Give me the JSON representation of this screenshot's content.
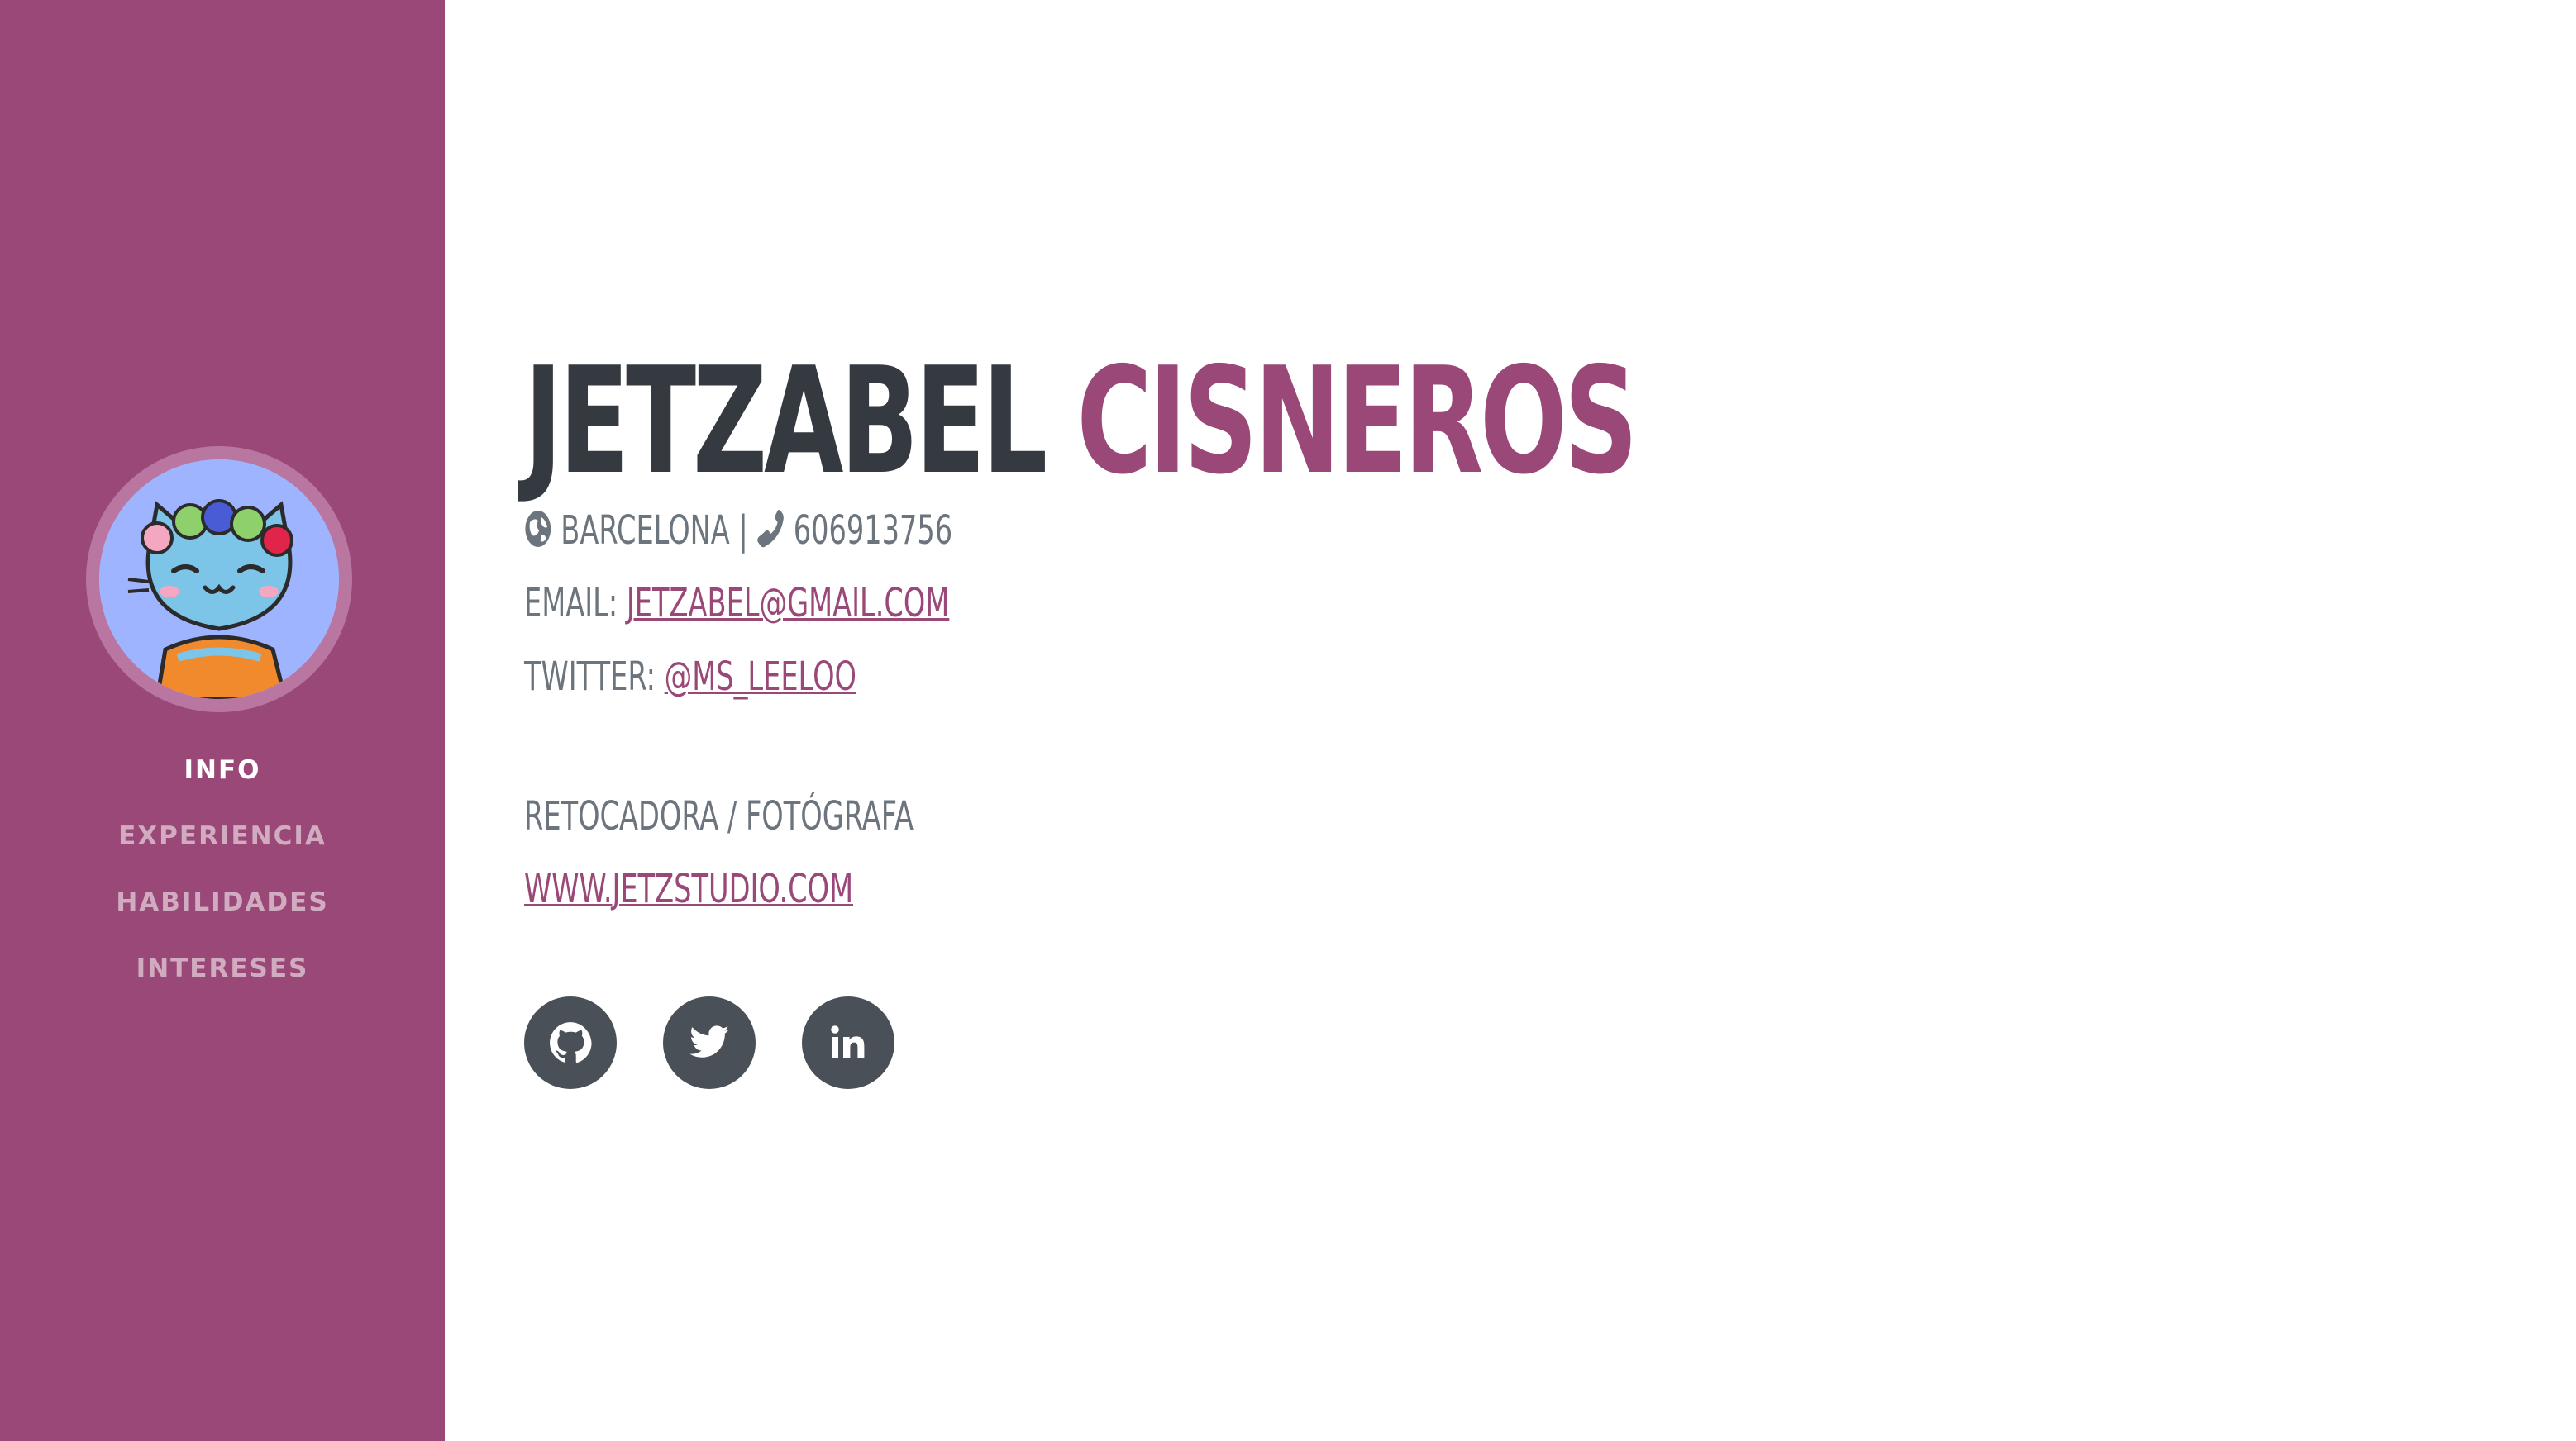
{
  "sidebar": {
    "nav": [
      {
        "label": "INFO",
        "active": true
      },
      {
        "label": "EXPERIENCIA",
        "active": false
      },
      {
        "label": "HABILIDADES",
        "active": false
      },
      {
        "label": "INTERESES",
        "active": false
      }
    ]
  },
  "profile": {
    "first_name": "JETZABEL",
    "last_name": "CISNEROS",
    "location": "BARCELONA",
    "separator": "|",
    "phone": "606913756",
    "email_label": "EMAIL:",
    "email": "JETZABEL@GMAIL.COM",
    "twitter_label": "TWITTER:",
    "twitter": "@MS_LEELOO",
    "role": "RETOCADORA / FOTÓGRAFA",
    "website": "WWW.JETZSTUDIO.COM"
  },
  "social": [
    {
      "icon": "github-icon"
    },
    {
      "icon": "twitter-icon"
    },
    {
      "icon": "linkedin-icon"
    }
  ],
  "colors": {
    "accent": "#994877",
    "dark": "#343a40",
    "muted": "#6c757d",
    "social_bg": "#495057",
    "avatar_bg": "#9fb4ff"
  }
}
